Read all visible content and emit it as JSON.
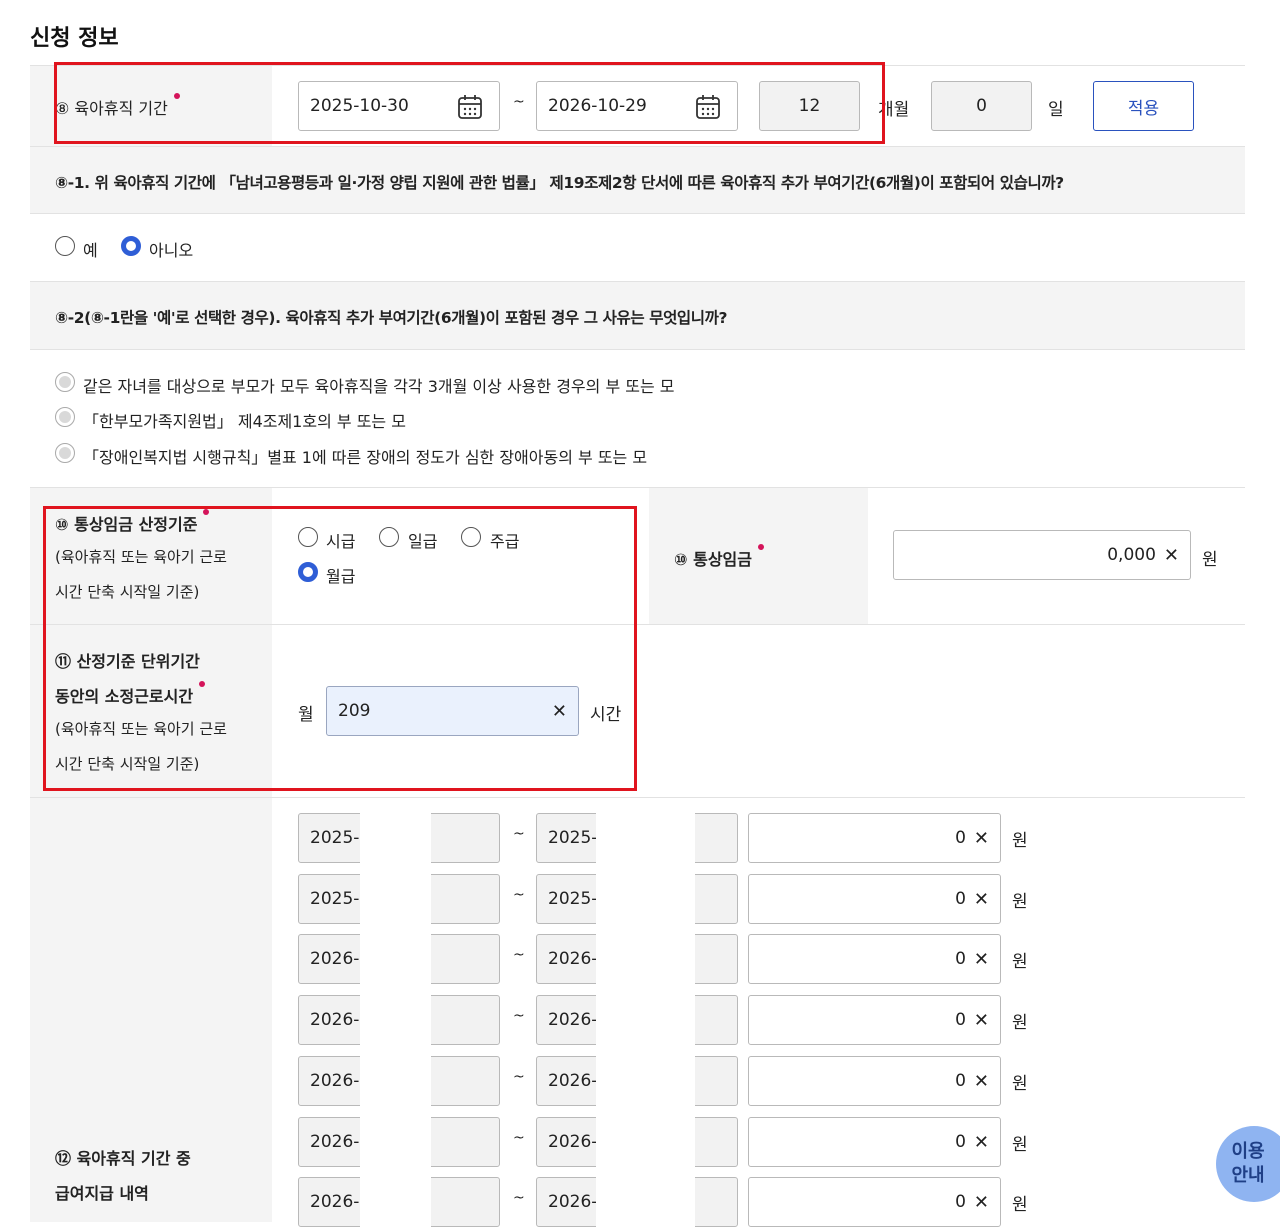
{
  "section_title": "신청 정보",
  "row8": {
    "label": "⑧ 육아휴직 기간",
    "start_date": "2025-10-30",
    "end_date": "2026-10-29",
    "tilde": "~",
    "months": "12",
    "months_unit": "개월",
    "days": "0",
    "days_unit": "일",
    "apply_button": "적용"
  },
  "q8_1": {
    "question": "⑧-1. 위 육아휴직 기간에 「남녀고용평등과 일·가정 양립 지원에 관한 법률」 제19조제2항 단서에 따른 육아휴직 추가 부여기간(6개월)이 포함되어 있습니까?",
    "options": [
      {
        "label": "예",
        "selected": false
      },
      {
        "label": "아니오",
        "selected": true
      }
    ]
  },
  "q8_2": {
    "question": "⑧-2(⑧-1란을 '예'로 선택한 경우). 육아휴직 추가 부여기간(6개월)이 포함된 경우 그 사유는 무엇입니까?",
    "options": [
      "같은 자녀를 대상으로 부모가 모두 육아휴직을 각각 3개월 이상 사용한 경우의 부 또는 모",
      "「한부모가족지원법」 제4조제1호의 부 또는 모",
      "「장애인복지법 시행규칙」별표 1에 따른 장애의 정도가 심한 장애아동의 부 또는 모"
    ]
  },
  "row10": {
    "label": "⑩ 통상임금 산정기준",
    "sub1": "(육아휴직 또는 육아기 근로",
    "sub2": "시간 단축 시작일 기준)",
    "options": [
      {
        "label": "시급",
        "selected": false
      },
      {
        "label": "일급",
        "selected": false
      },
      {
        "label": "주급",
        "selected": false
      },
      {
        "label": "월급",
        "selected": true
      }
    ],
    "wage_label": "⑩ 통상임금",
    "wage_value": "0,000",
    "wage_unit": "원"
  },
  "row11": {
    "label1": "⑪ 산정기준 단위기간",
    "label2": "동안의 소정근로시간",
    "sub1": "(육아휴직 또는 육아기 근로",
    "sub2": "시간 단축 시작일 기준)",
    "prefix": "월",
    "value": "209",
    "unit": "시간"
  },
  "row12": {
    "label1": "⑫ 육아휴직 기간 중",
    "label2": "급여지급 내역",
    "tilde": "~",
    "unit": "원",
    "rows": [
      {
        "start": "2025-",
        "end": "2025-",
        "amount": "0"
      },
      {
        "start": "2025-",
        "end": "2025-",
        "amount": "0"
      },
      {
        "start": "2026-",
        "end": "2026-",
        "amount": "0"
      },
      {
        "start": "2026-",
        "end": "2026-",
        "amount": "0"
      },
      {
        "start": "2026-",
        "end": "2026-",
        "amount": "0"
      },
      {
        "start": "2026-",
        "end": "2026-",
        "amount": "0"
      },
      {
        "start": "2026-",
        "end": "2026-",
        "amount": "0"
      }
    ]
  },
  "clear_glyph": "✕",
  "help_button": {
    "line1": "이용",
    "line2": "안내"
  }
}
